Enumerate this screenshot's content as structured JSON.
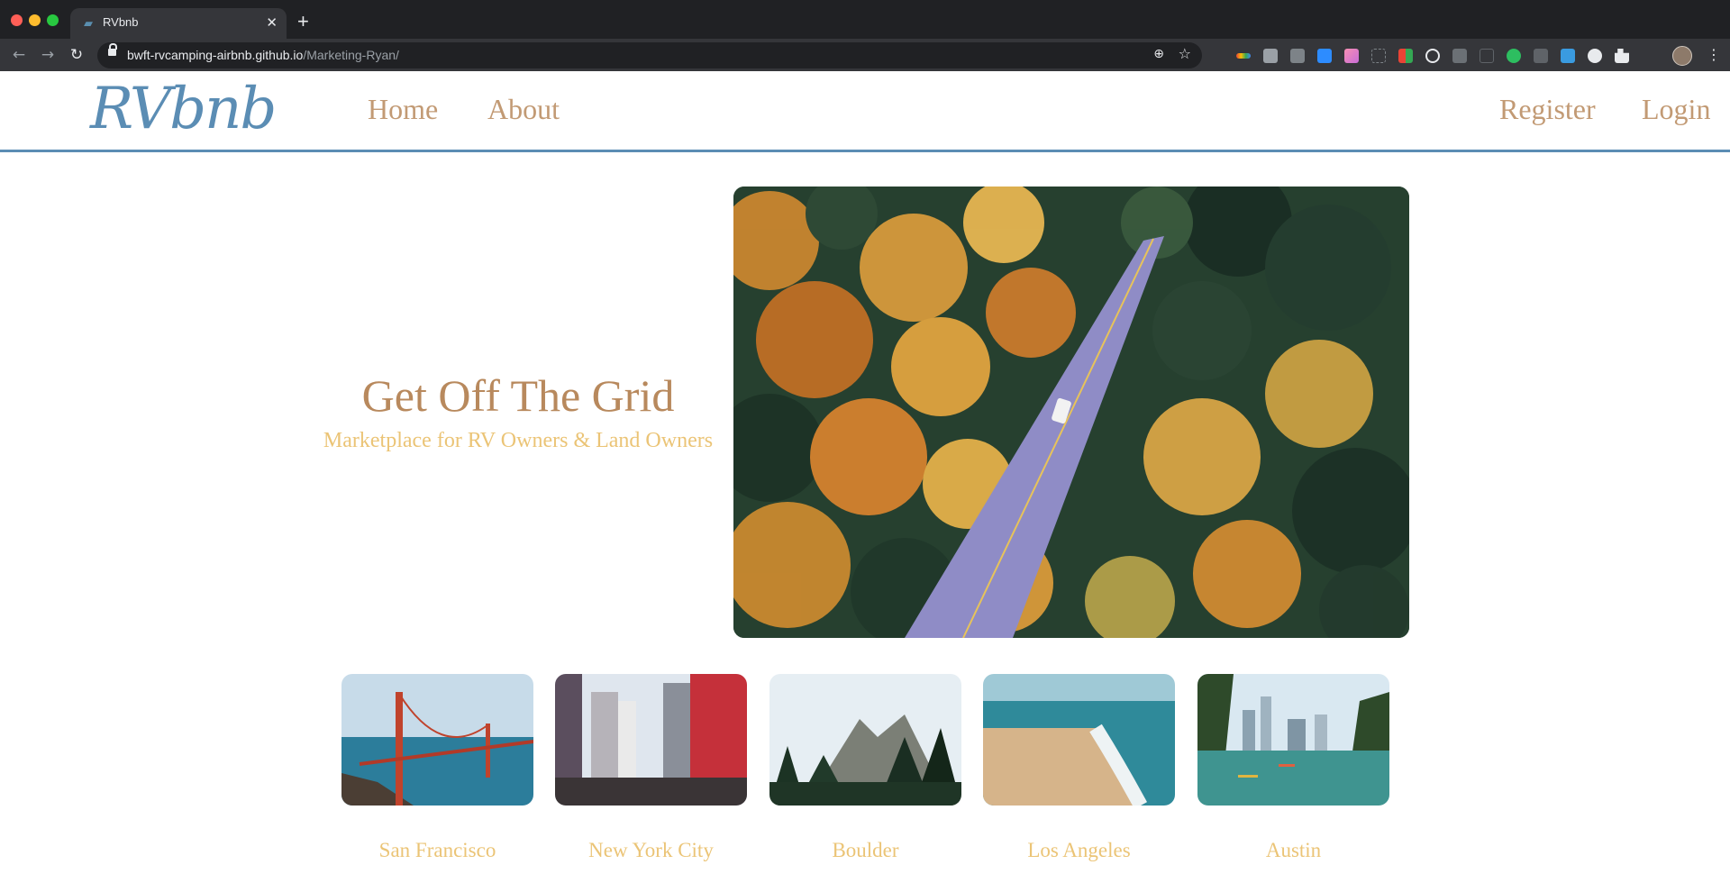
{
  "browser": {
    "tab_title": "RVbnb",
    "new_tab_glyph": "+",
    "tab_close_glyph": "✕",
    "url_host": "bwft-rvcamping-airbnb.github.io",
    "url_path": "/Marketing-Ryan/",
    "icons": [
      "back-icon",
      "forward-icon",
      "reload-icon",
      "lock-icon",
      "zoom-icon",
      "star-icon",
      "extensions-icon",
      "avatar",
      "menu-icon"
    ]
  },
  "site": {
    "logo": "RVbnb",
    "nav": {
      "home": "Home",
      "about": "About",
      "register": "Register",
      "login": "Login"
    }
  },
  "hero": {
    "title": "Get Off The Grid",
    "subtitle": "Marketplace for RV Owners & Land Owners"
  },
  "cities": [
    {
      "name": "San Francisco"
    },
    {
      "name": "New York City"
    },
    {
      "name": "Boulder"
    },
    {
      "name": "Los Angeles"
    },
    {
      "name": "Austin"
    }
  ],
  "colors": {
    "brand_blue": "#5b8db4",
    "nav_link": "#c29a74",
    "hero_title": "#b8895d",
    "accent_yellow": "#ebc476"
  }
}
